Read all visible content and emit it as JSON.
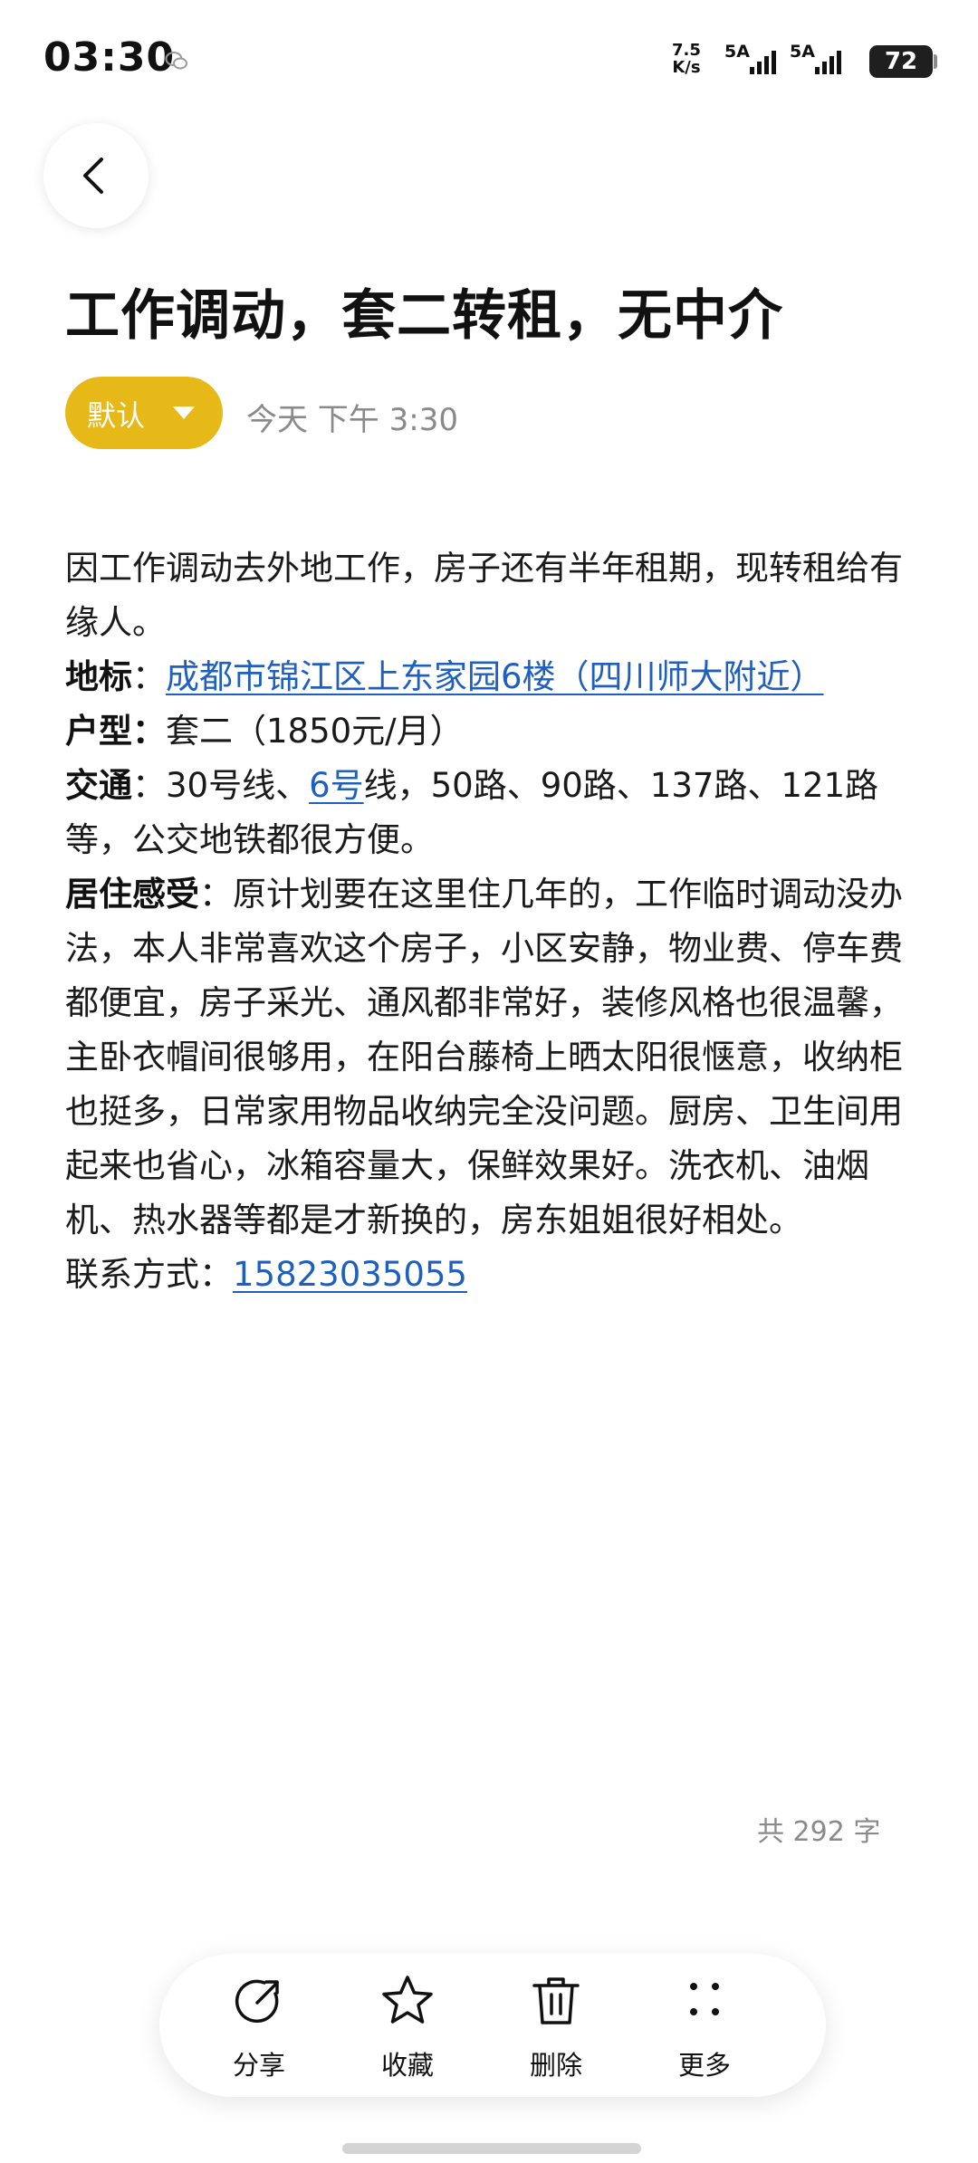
{
  "status_bar": {
    "time": "03:30",
    "net_speed_value": "7.5",
    "net_speed_unit": "K/s",
    "sim1_label": "5A",
    "sim2_label": "5A",
    "battery": "72"
  },
  "note": {
    "title": "工作调动，套二转租，无中介",
    "category": "默认",
    "timestamp": "今天 下午 3:30",
    "intro": "因工作调动去外地工作，房子还有半年租期，现转租给有缘人。",
    "landmark_label": "地标",
    "landmark_sep": "：",
    "landmark_value": "成都市锦江区上东家园6楼（四川师大附近）",
    "layout_label": "户型：",
    "layout_value": "套二（1850元/月）",
    "transport_label": "交通",
    "transport_prefix": "：30号线、",
    "transport_link": "6号",
    "transport_suffix": "线，50路、90路、137路、121路等，公交地铁都很方便。",
    "feeling_label": "居住感受",
    "feeling_value": "：原计划要在这里住几年的，工作临时调动没办法，本人非常喜欢这个房子，小区安静，物业费、停车费都便宜，房子采光、通风都非常好，装修风格也很温馨，主卧衣帽间很够用，在阳台藤椅上晒太阳很惬意，收纳柜也挺多，日常家用物品收纳完全没问题。厨房、卫生间用起来也省心，冰箱容量大，保鲜效果好。洗衣机、油烟机、热水器等都是才新换的，房东姐姐很好相处。",
    "contact_label": "联系方式：",
    "contact_phone": "15823035055",
    "word_count": "共 292 字"
  },
  "toolbar": {
    "share": "分享",
    "favorite": "收藏",
    "delete": "删除",
    "more": "更多"
  },
  "colors": {
    "accent_yellow": "#e6b818",
    "link_blue": "#1f5fbf",
    "muted_gray": "#8a8a8a"
  }
}
